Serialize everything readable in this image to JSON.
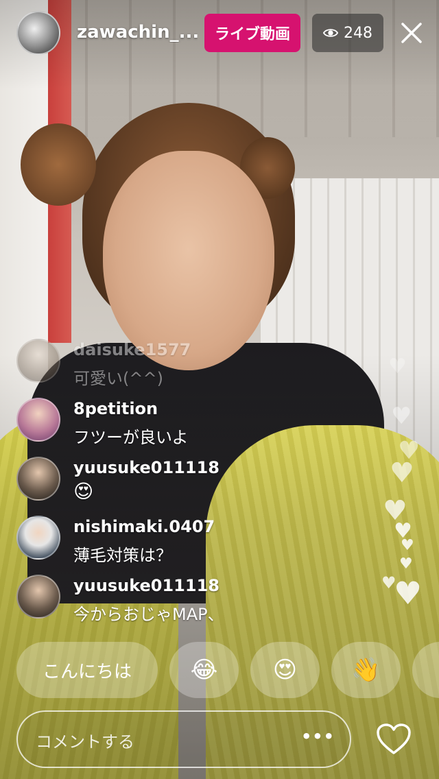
{
  "header": {
    "host_name": "zawachin_...",
    "live_label": "ライブ動画",
    "viewer_count": "248",
    "live_color": "#d6126f"
  },
  "comments": [
    {
      "user": "daisuke1577",
      "text": "可愛い(^^)"
    },
    {
      "user": "8petition",
      "text": "フツーが良いよ"
    },
    {
      "user": "yuusuke011118",
      "text": "😍"
    },
    {
      "user": "nishimaki.0407",
      "text": "薄毛対策は？"
    },
    {
      "user": "yuusuke011118",
      "text": "今からおじゃMAP、"
    }
  ],
  "quick_reactions": [
    "こんにちは",
    "😂",
    "😍",
    "👋"
  ],
  "comment_bar": {
    "placeholder": "コメントする",
    "more": "•••"
  },
  "icons": {
    "viewer": "eye-icon",
    "close": "close-icon",
    "like": "heart-outline-icon",
    "hearts_stream": "heart-icon"
  }
}
